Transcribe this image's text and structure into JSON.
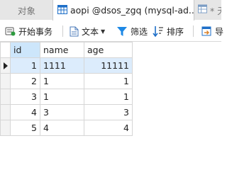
{
  "tabs": [
    {
      "label": "对象",
      "icon": "objects-icon"
    },
    {
      "label": "aopi @dsos_zgq (mysql-ad...",
      "icon": "table-icon"
    },
    {
      "label": "* 无",
      "icon": "table-icon"
    }
  ],
  "toolbar": {
    "begin_transaction": "开始事务",
    "text": "文本",
    "filter": "筛选",
    "sort": "排序",
    "import": "导"
  },
  "grid": {
    "columns": [
      "id",
      "name",
      "age"
    ],
    "rows": [
      {
        "id": "1",
        "name": "1111",
        "age": "11111"
      },
      {
        "id": "2",
        "name": "1",
        "age": "1"
      },
      {
        "id": "3",
        "name": "1",
        "age": "1"
      },
      {
        "id": "4",
        "name": "3",
        "age": "3"
      },
      {
        "id": "5",
        "name": "4",
        "age": "4"
      }
    ],
    "selected_row": 0
  },
  "colors": {
    "accent": "#1e88e5",
    "selected_cell": "#dcecfc",
    "selected_header": "#cde6fb"
  }
}
